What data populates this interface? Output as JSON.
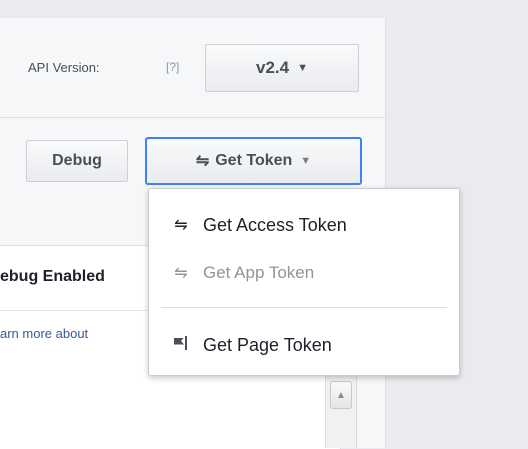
{
  "api": {
    "label": "API Version:",
    "help": "[?]",
    "version": "v2.4"
  },
  "toolbar": {
    "debug_label": "Debug",
    "get_token_label": "Get Token"
  },
  "content": {
    "debug_enabled": "ebug Enabled",
    "learn_more": "arn more about"
  },
  "menu": {
    "items": [
      {
        "label": "Get Access Token",
        "icon": "swap-arrows-icon",
        "disabled": false
      },
      {
        "label": "Get App Token",
        "icon": "swap-arrows-icon",
        "disabled": true
      },
      {
        "label": "Get Page Token",
        "icon": "page-flag-icon",
        "disabled": false
      }
    ]
  },
  "colors": {
    "focus_border": "#4080ff",
    "disabled_text": "#90949c",
    "link": "#385898"
  }
}
